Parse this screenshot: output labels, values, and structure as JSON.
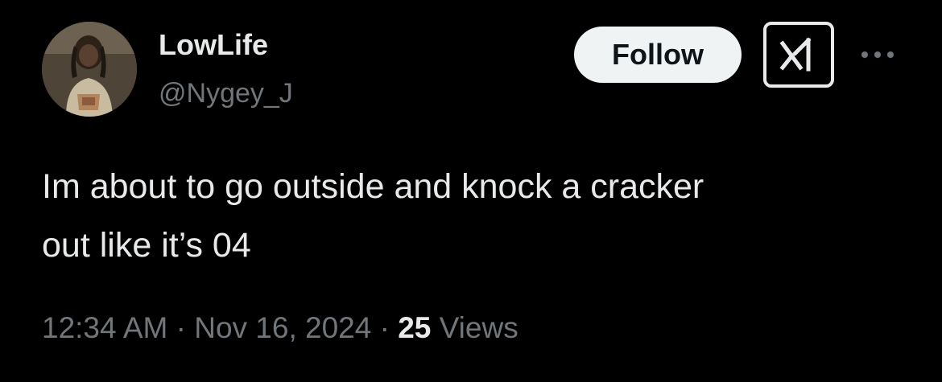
{
  "author": {
    "display_name": "LowLife",
    "handle": "@Nygey_J"
  },
  "actions": {
    "follow_label": "Follow",
    "grok_icon": "grok-logo-icon",
    "more_icon": "more-horizontal-icon"
  },
  "tweet": {
    "text": "Im about to go outside and knock a cracker\nout like it’s 04",
    "time": "12:34 AM",
    "separator": "·",
    "date": "Nov 16, 2024",
    "views_count": "25",
    "views_label": "Views"
  },
  "colors": {
    "background": "#000000",
    "primary_text": "#e7e9ea",
    "secondary_text": "#71767b",
    "follow_button_bg": "#eff3f4"
  }
}
